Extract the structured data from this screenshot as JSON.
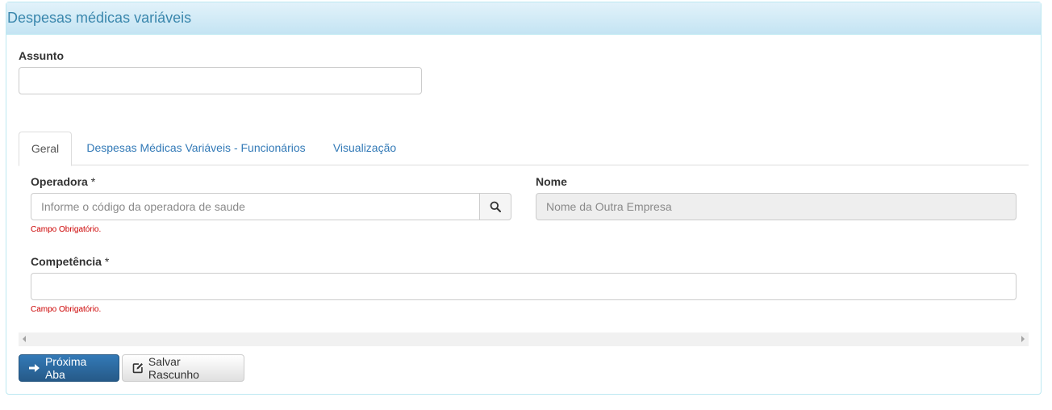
{
  "panel": {
    "title": "Despesas médicas variáveis"
  },
  "subject": {
    "label": "Assunto",
    "value": ""
  },
  "tabs": [
    {
      "label": "Geral",
      "active": true
    },
    {
      "label": "Despesas Médicas Variáveis - Funcionários",
      "active": false
    },
    {
      "label": "Visualização",
      "active": false
    }
  ],
  "operator": {
    "label": "Operadora",
    "required_mark": "*",
    "placeholder": "Informe o código da operadora de saude",
    "error": "Campo Obrigatório."
  },
  "name": {
    "label": "Nome",
    "placeholder": "Nome da Outra Empresa"
  },
  "competence": {
    "label": "Competência",
    "required_mark": "*",
    "error": "Campo Obrigatório."
  },
  "buttons": {
    "next_tab": "Próxima Aba",
    "save_draft": "Salvar Rascunho"
  },
  "icons": {
    "search": "search-icon",
    "arrow_right": "arrow-right-icon",
    "edit": "edit-icon"
  },
  "colors": {
    "heading_text": "#3a87ad",
    "primary": "#337ab7",
    "error": "#cc0000"
  }
}
